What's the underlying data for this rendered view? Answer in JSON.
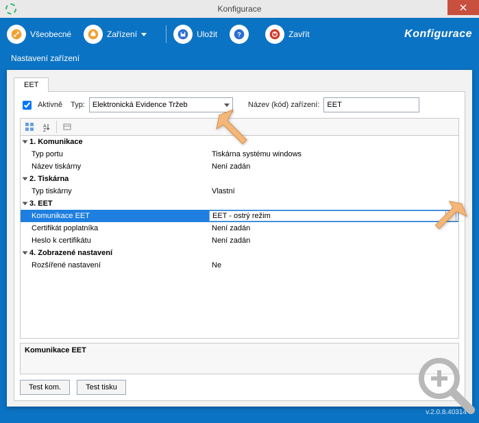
{
  "window": {
    "title": "Konfigurace"
  },
  "toolbar": {
    "general": "Všeobecné",
    "device": "Zařízení",
    "save": "Uložit",
    "close": "Zavřít",
    "app_title": "Konfigurace"
  },
  "subtitle": "Nastavení zařízení",
  "tab": {
    "label": "EET"
  },
  "form": {
    "active_label": "Aktivně",
    "type_label": "Typ:",
    "type_value": "Elektronická Evidence Tržeb",
    "name_label": "Název (kód) zařízení:",
    "name_value": "EET"
  },
  "groups": [
    {
      "title": "1. Komunikace",
      "rows": [
        {
          "label": "Typ portu",
          "value": "Tiskárna systému windows"
        },
        {
          "label": "Název tiskárny",
          "value": "Není zadán"
        }
      ]
    },
    {
      "title": "2. Tiskárna",
      "rows": [
        {
          "label": "Typ tiskárny",
          "value": "Vlastní"
        }
      ]
    },
    {
      "title": "3. EET",
      "rows": [
        {
          "label": "Komunikace EET",
          "value": "EET - ostrý režim",
          "selected": true,
          "dropdown": true
        },
        {
          "label": "Certifikát poplatníka",
          "value": "Není zadán"
        },
        {
          "label": "Heslo k certifikátu",
          "value": "Není zadán"
        }
      ]
    },
    {
      "title": "4. Zobrazené nastavení",
      "rows": [
        {
          "label": "Rozšířené nastavení",
          "value": "Ne"
        }
      ]
    }
  ],
  "description": "Komunikace EET",
  "buttons": {
    "test_com": "Test kom.",
    "test_print": "Test tisku"
  },
  "version": "v.2.0.8.40314"
}
